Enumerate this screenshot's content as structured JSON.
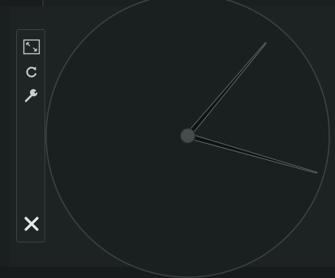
{
  "toolbar": {
    "buttons": [
      {
        "icon": "expand-icon",
        "action": "expand"
      },
      {
        "icon": "refresh-icon",
        "action": "refresh"
      },
      {
        "icon": "wrench-icon",
        "action": "settings"
      },
      {
        "icon": "close-icon",
        "action": "close"
      }
    ]
  },
  "clock": {
    "hour_hand_angle_deg": 40,
    "minute_hand_angle_deg": 106
  },
  "colors": {
    "background": "#1d2222",
    "dial": "#1a1f1f",
    "dial_outline": "#3b4444",
    "hands": "#0f1212",
    "hand_edge": "#5d6666",
    "center_hub": "#454c4c",
    "toolbar_border": "#3a4242",
    "icon": "#c9d0d0",
    "close_icon": "#e6eaea"
  }
}
